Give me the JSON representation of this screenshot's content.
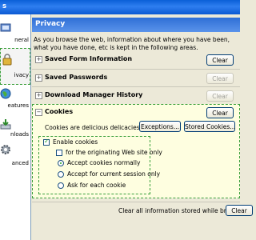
{
  "window": {
    "title": "s"
  },
  "sidebar": {
    "items": [
      {
        "label": "neral",
        "icon": "general-icon"
      },
      {
        "label": "ivacy",
        "icon": "privacy-lock-icon",
        "selected": true
      },
      {
        "label": "eatures",
        "icon": "web-features-icon"
      },
      {
        "label": "nloads",
        "icon": "downloads-icon"
      },
      {
        "label": "anced",
        "icon": "advanced-gear-icon"
      }
    ]
  },
  "header": {
    "title": "Privacy"
  },
  "intro_text": "As you browse the web, information about where you have been, what you have done, etc is kept in the following areas.",
  "sections": {
    "saved_form": {
      "label": "Saved Form Information",
      "button": "Clear",
      "enabled": true
    },
    "saved_passwords": {
      "label": "Saved Passwords",
      "button": "Clear",
      "enabled": false
    },
    "download_history": {
      "label": "Download Manager History",
      "button": "Clear",
      "enabled": false
    },
    "cookies": {
      "label": "Cookies",
      "button": "Clear",
      "description": "Cookies are delicious delicacies.",
      "exceptions_button": "Exceptions...",
      "stored_button": "Stored Cookies...",
      "enable_label": "Enable cookies",
      "enable_checked": true,
      "originating_label": "for the originating Web site only",
      "originating_checked": false,
      "radio_options": [
        {
          "label": "Accept cookies normally",
          "selected": true
        },
        {
          "label": "Accept for current session only",
          "selected": false
        },
        {
          "label": "Ask for each cookie",
          "selected": false
        }
      ]
    }
  },
  "footer": {
    "text": "Clear all information stored while browsing:",
    "button": "Clear"
  },
  "colors": {
    "accent": "#2f6fd6",
    "selection_outline": "#3ca03c",
    "panel_bg": "#fefee0"
  }
}
